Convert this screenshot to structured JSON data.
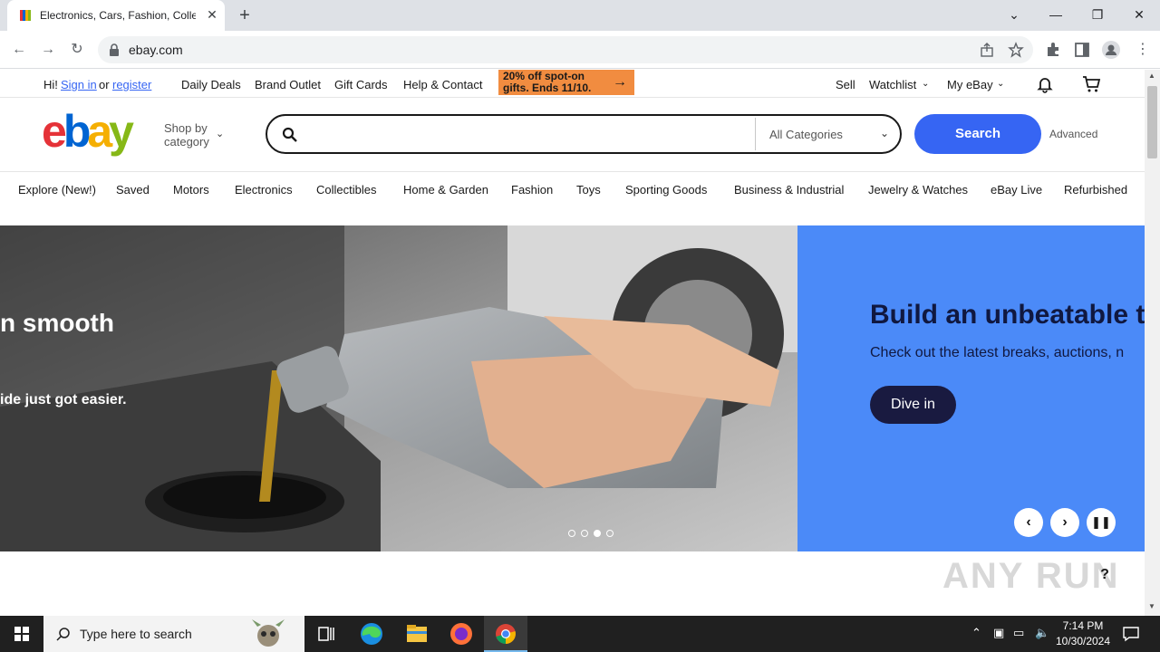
{
  "browser": {
    "tab_title": "Electronics, Cars, Fashion, Collectibles & More | eBay",
    "url": "ebay.com",
    "new_tab": "+",
    "tab_close": "✕"
  },
  "topbar": {
    "greeting": "Hi!",
    "sign_in": "Sign in",
    "or": "or",
    "register": "register",
    "links": [
      "Daily Deals",
      "Brand Outlet",
      "Gift Cards",
      "Help & Contact"
    ],
    "promo": "20% off spot-on gifts. Ends 11/10.",
    "sell": "Sell",
    "watchlist": "Watchlist",
    "my_ebay": "My eBay"
  },
  "header": {
    "logo_letters": [
      "e",
      "b",
      "a",
      "y"
    ],
    "logo_colors": [
      "#e53238",
      "#0064d2",
      "#f5af02",
      "#86b817"
    ],
    "shop_by_line1": "Shop by",
    "shop_by_line2": "category",
    "search_placeholder": "",
    "category_select": "All Categories",
    "search_button": "Search",
    "advanced": "Advanced"
  },
  "categories": [
    "Explore (New!)",
    "Saved",
    "Motors",
    "Electronics",
    "Collectibles",
    "Home & Garden",
    "Fashion",
    "Toys",
    "Sporting Goods",
    "Business & Industrial",
    "Jewelry & Watches",
    "eBay Live",
    "Refurbished"
  ],
  "hero": {
    "overlay_title": "n smooth",
    "overlay_sub": "ide just got easier.",
    "heading": "Build an unbeatable t",
    "subtext": "Check out the latest breaks, auctions, n",
    "cta": "Dive in",
    "active_slide": 3,
    "total_slides": 4
  },
  "help": "?",
  "watermark": "ANY RUN",
  "taskbar": {
    "search_placeholder": "Type here to search",
    "time": "7:14 PM",
    "date": "10/30/2024"
  },
  "colors": {
    "ebay_blue": "#3665f3",
    "promo_orange": "#f18c40",
    "hero_blue": "#4b8af8",
    "hero_dark": "#191a40"
  }
}
